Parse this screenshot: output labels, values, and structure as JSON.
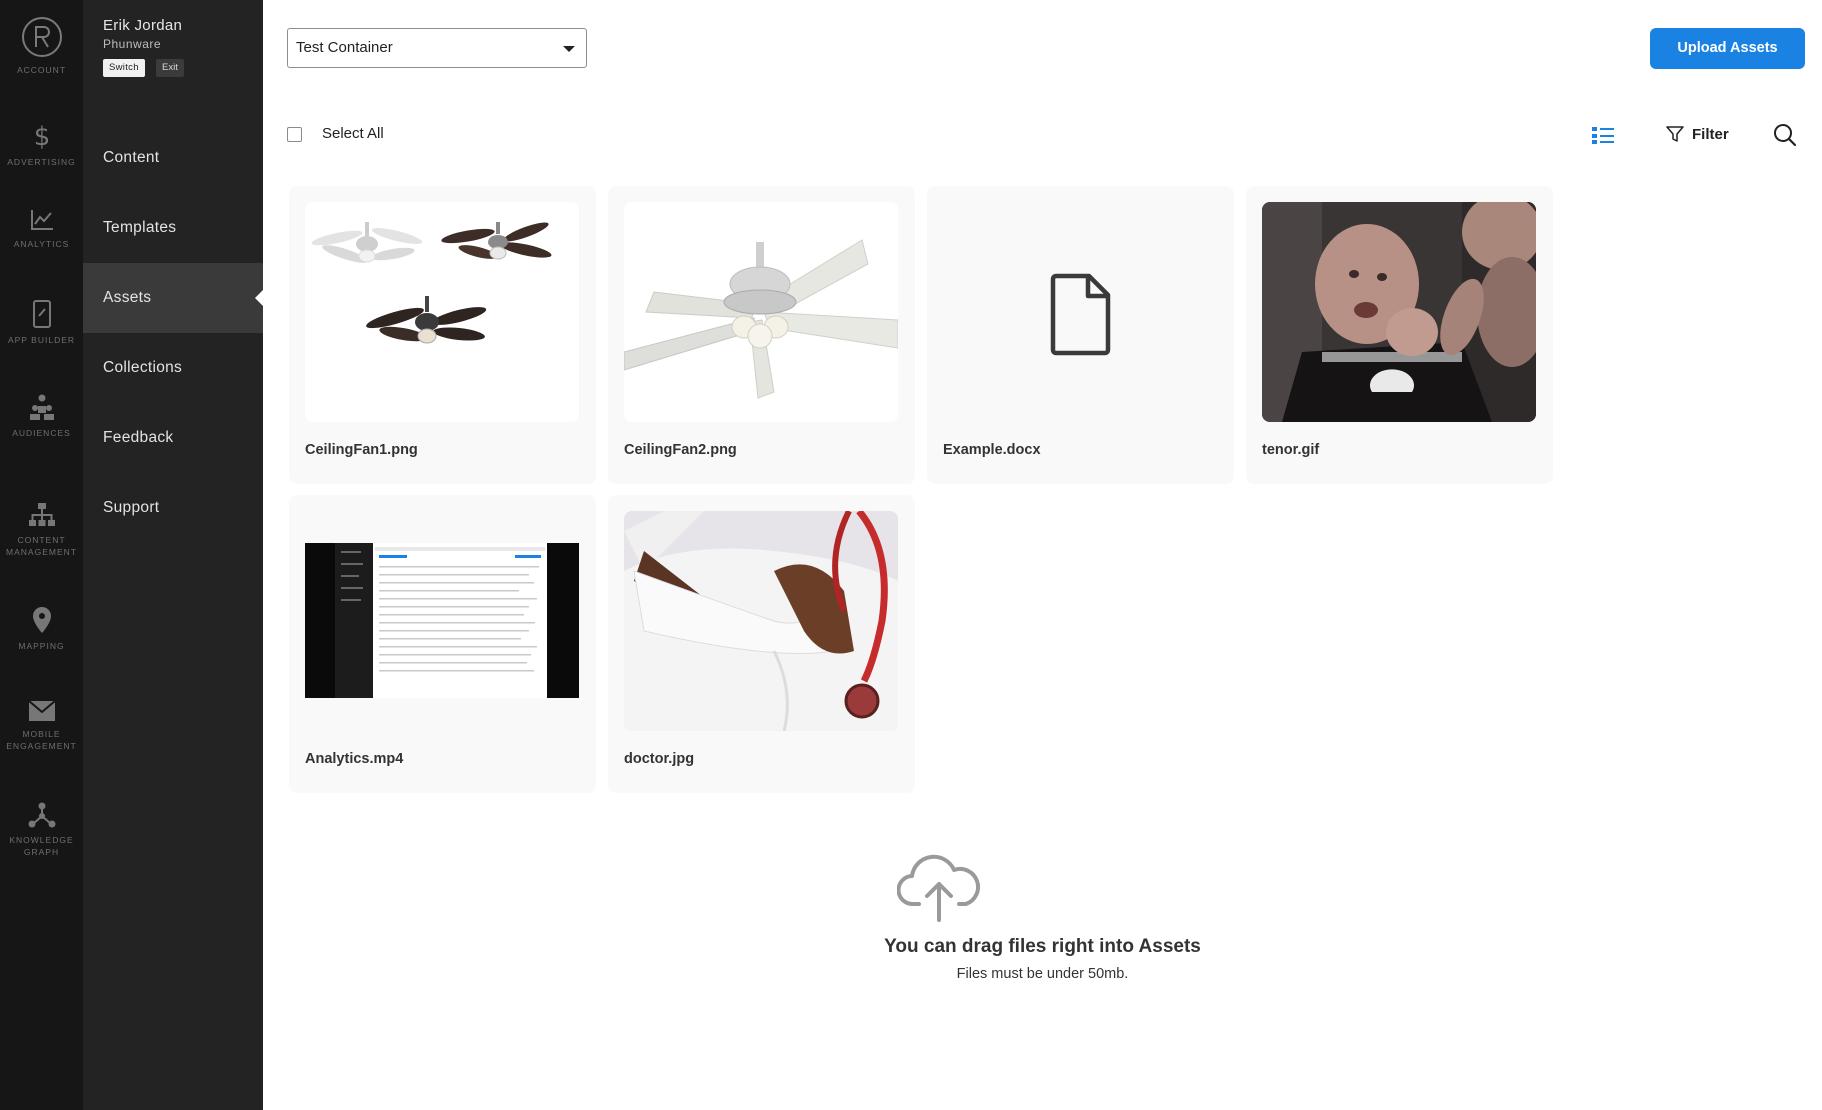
{
  "rail": {
    "account_label": "ACCOUNT",
    "items": [
      {
        "label": "ADVERTISING",
        "icon": "dollar-icon"
      },
      {
        "label": "ANALYTICS",
        "icon": "line-chart-icon"
      },
      {
        "label": "APP BUILDER",
        "icon": "phone-icon"
      },
      {
        "label": "AUDIENCES",
        "icon": "people-icon"
      },
      {
        "label": "CONTENT MANAGEMENT",
        "icon": "hierarchy-icon"
      },
      {
        "label": "MAPPING",
        "icon": "map-pin-icon"
      },
      {
        "label": "MOBILE ENGAGEMENT",
        "icon": "envelope-icon"
      },
      {
        "label": "KNOWLEDGE GRAPH",
        "icon": "graph-icon"
      }
    ]
  },
  "user": {
    "name": "Erik Jordan",
    "org": "Phunware",
    "switch_label": "Switch",
    "exit_label": "Exit"
  },
  "nav": {
    "items": [
      {
        "label": "Content"
      },
      {
        "label": "Templates"
      },
      {
        "label": "Assets",
        "active": true
      },
      {
        "label": "Collections"
      },
      {
        "label": "Feedback"
      },
      {
        "label": "Support"
      }
    ]
  },
  "toolbar": {
    "container_select_value": "Test Container",
    "upload_label": "Upload Assets",
    "select_all_label": "Select All",
    "filter_label": "Filter"
  },
  "assets": [
    {
      "name": "CeilingFan1.png",
      "thumb": "three-ceiling-fans"
    },
    {
      "name": "CeilingFan2.png",
      "thumb": "white-ceiling-fan"
    },
    {
      "name": "Example.docx",
      "thumb": "document-icon"
    },
    {
      "name": "tenor.gif",
      "thumb": "baby-photo"
    },
    {
      "name": "Analytics.mp4",
      "thumb": "video-screenshot"
    },
    {
      "name": "doctor.jpg",
      "thumb": "doctor-photo"
    }
  ],
  "drop_zone": {
    "title": "You can drag files right into Assets",
    "subtitle": "Files must be under 50mb."
  },
  "colors": {
    "accent": "#1a82e2",
    "rail_bg": "#161616",
    "nav_bg": "#232323",
    "nav_active_bg": "#3a3a3a"
  }
}
